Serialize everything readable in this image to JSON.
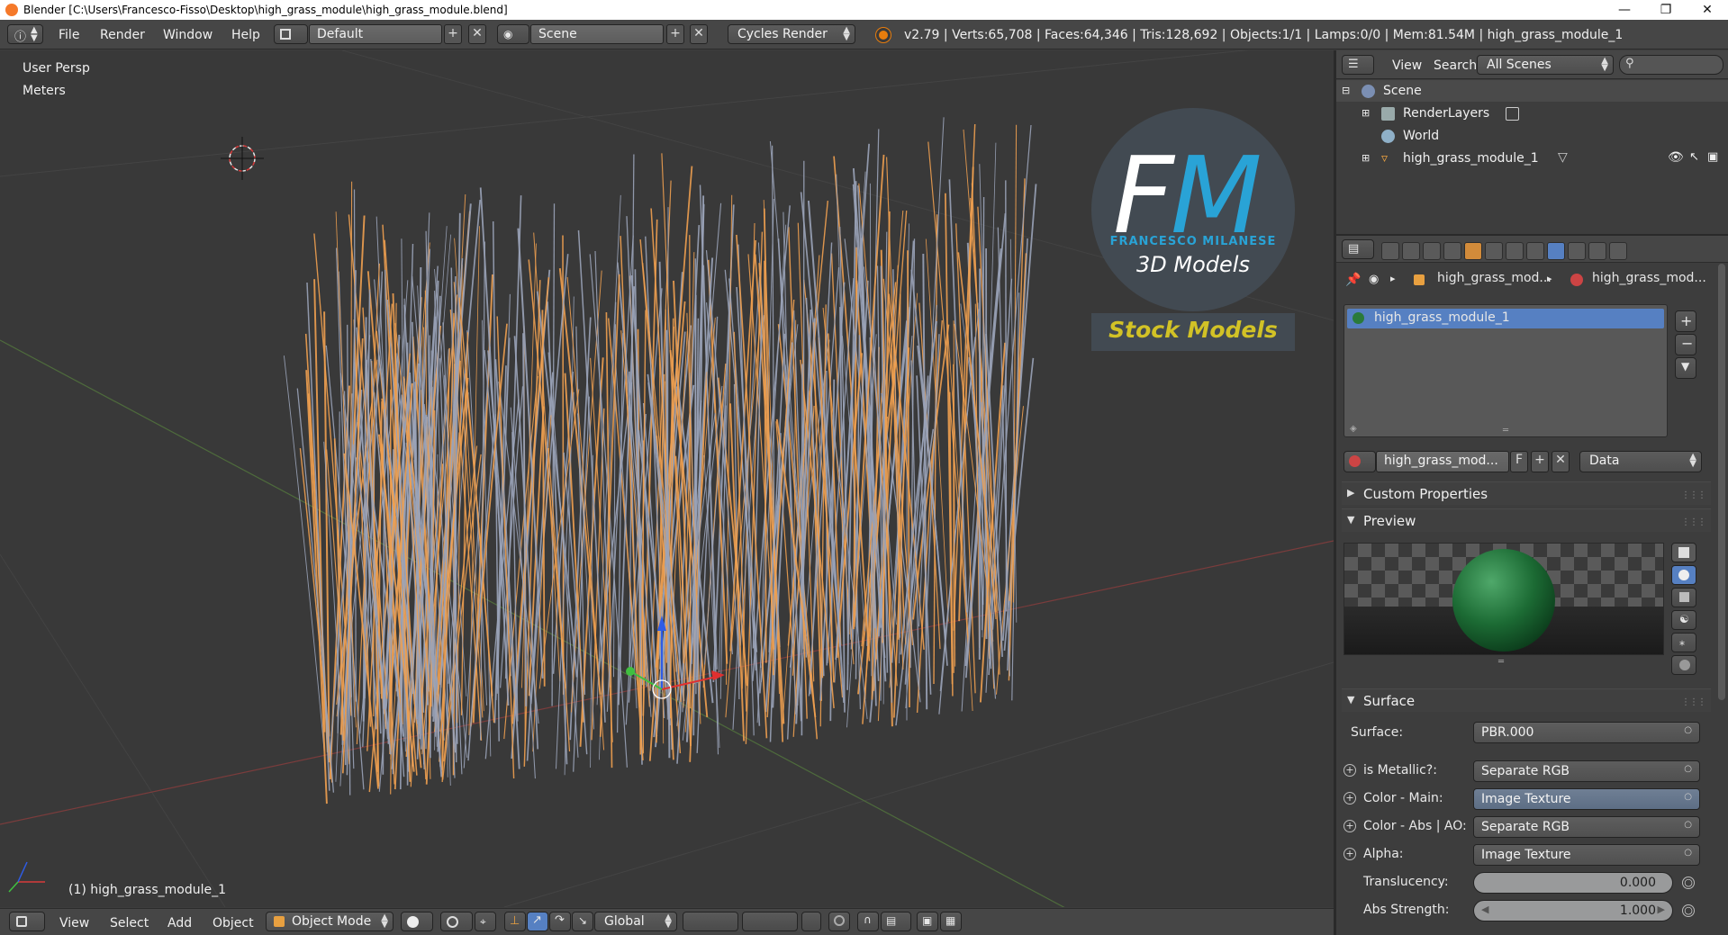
{
  "window": {
    "title": "Blender [C:\\Users\\Francesco-Fisso\\Desktop\\high_grass_module\\high_grass_module.blend]"
  },
  "menu": {
    "file": "File",
    "render": "Render",
    "window": "Window",
    "help": "Help"
  },
  "header": {
    "screen_layout": "Default",
    "scene": "Scene",
    "render_engine": "Cycles Render",
    "stats": "v2.79 | Verts:65,708 | Faces:64,346 | Tris:128,692 | Objects:1/1 | Lamps:0/0 | Mem:81.54M | high_grass_module_1"
  },
  "viewport": {
    "view_name": "User Persp",
    "units": "Meters",
    "active_object": "(1) high_grass_module_1",
    "watermark": {
      "letter_f": "F",
      "letter_m": "M",
      "name": "FRANCESCO MILANESE",
      "subtitle": "3D Models",
      "tag": "Stock Models"
    }
  },
  "viewport_footer": {
    "view": "View",
    "select": "Select",
    "add": "Add",
    "object": "Object",
    "mode": "Object Mode",
    "orientation": "Global"
  },
  "outliner": {
    "menu_view": "View",
    "menu_search": "Search",
    "display_mode": "All Scenes",
    "items": [
      {
        "label": "Scene"
      },
      {
        "label": "RenderLayers"
      },
      {
        "label": "World"
      },
      {
        "label": "high_grass_module_1"
      }
    ]
  },
  "properties": {
    "breadcrumb_object": "high_grass_mod...",
    "breadcrumb_material": "high_grass_mod...",
    "material_slots": [
      {
        "label": "high_grass_module_1"
      }
    ],
    "material_name": "high_grass_mod...",
    "fake_user": "F",
    "link_mode": "Data",
    "panels": {
      "custom_properties": "Custom Properties",
      "preview": "Preview",
      "surface": "Surface"
    },
    "surface": {
      "surface_label": "Surface:",
      "surface_value": "PBR.000",
      "rows": [
        {
          "label": "is Metallic?:",
          "value": "Separate RGB",
          "highlight": false
        },
        {
          "label": "Color - Main:",
          "value": "Image Texture",
          "highlight": true
        },
        {
          "label": "Color - Abs | AO:",
          "value": "Separate RGB",
          "highlight": false
        },
        {
          "label": "Alpha:",
          "value": "Image Texture",
          "highlight": false
        }
      ],
      "translucency_label": "Translucency:",
      "translucency_value": "0.000",
      "abs_strength_label": "Abs Strength:",
      "abs_strength_value": "1.000"
    }
  },
  "colors": {
    "grass_selected": "#f0a050",
    "grass_base": "#9aa3b8",
    "logo_blue": "#29a3d6",
    "logo_yellow": "#d2c226",
    "active_row": "#5680c2"
  }
}
